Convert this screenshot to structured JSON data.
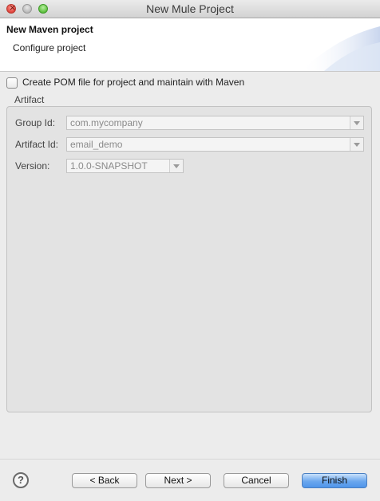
{
  "window": {
    "title": "New Mule Project"
  },
  "header": {
    "title": "New Maven project",
    "subtitle": "Configure project"
  },
  "pom_checkbox": {
    "label": "Create POM file for project and maintain with Maven",
    "checked": false
  },
  "artifact_group": {
    "label": "Artifact",
    "fields": [
      {
        "label": "Group Id:",
        "value": "com.mycompany"
      },
      {
        "label": "Artifact Id:",
        "value": "email_demo"
      },
      {
        "label": "Version:",
        "value": "1.0.0-SNAPSHOT"
      }
    ]
  },
  "buttons": {
    "help": "?",
    "back": "< Back",
    "next": "Next >",
    "cancel": "Cancel",
    "finish": "Finish"
  },
  "colors": {
    "primary_button": "#5a9cec",
    "close_light": "#e0443e",
    "max_light": "#5fbf3f"
  }
}
